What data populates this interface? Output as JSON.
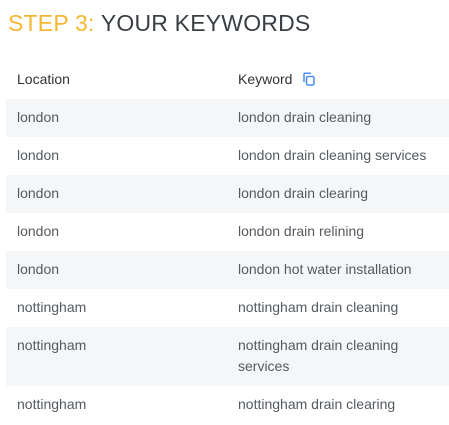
{
  "heading": {
    "prefix": "STEP 3:",
    "title": "YOUR KEYWORDS"
  },
  "table": {
    "columns": {
      "location": "Location",
      "keyword": "Keyword"
    },
    "rows": [
      {
        "location": "london",
        "keyword": "london drain cleaning"
      },
      {
        "location": "london",
        "keyword": "london drain cleaning services"
      },
      {
        "location": "london",
        "keyword": "london drain clearing"
      },
      {
        "location": "london",
        "keyword": "london drain relining"
      },
      {
        "location": "london",
        "keyword": "london hot water installation"
      },
      {
        "location": "nottingham",
        "keyword": "nottingham drain cleaning"
      },
      {
        "location": "nottingham",
        "keyword": "nottingham drain cleaning services"
      },
      {
        "location": "nottingham",
        "keyword": "nottingham drain clearing"
      }
    ]
  },
  "icons": {
    "copy": "copy-icon"
  },
  "colors": {
    "accent": "#f5b731",
    "icon": "#4a8df6",
    "stripe": "#f5f6f8"
  }
}
